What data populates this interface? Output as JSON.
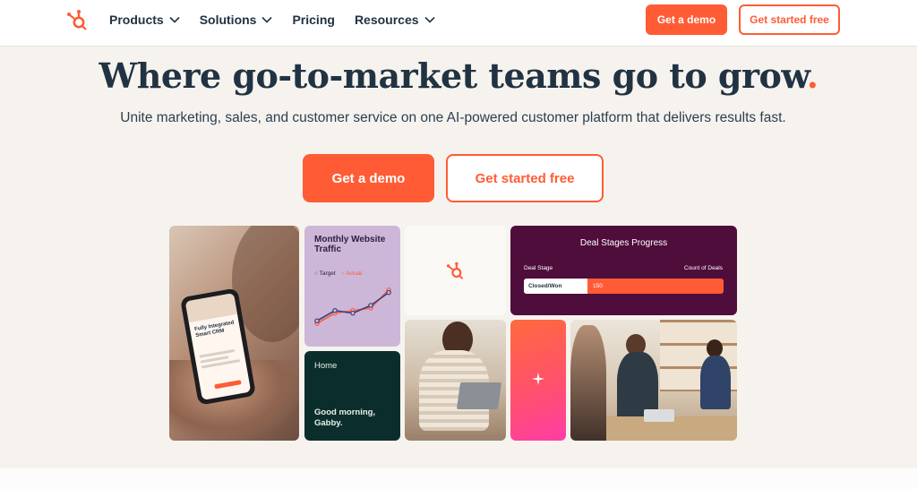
{
  "header": {
    "nav": [
      {
        "label": "Products",
        "has_chevron": true
      },
      {
        "label": "Solutions",
        "has_chevron": true
      },
      {
        "label": "Pricing",
        "has_chevron": false
      },
      {
        "label": "Resources",
        "has_chevron": true
      }
    ],
    "demo_label": "Get a demo",
    "free_label": "Get started free"
  },
  "hero": {
    "title": "Where go-to-market teams go to grow",
    "title_dot": ".",
    "subtitle": "Unite marketing, sales, and customer service on one AI-powered customer platform that delivers results fast.",
    "demo_label": "Get a demo",
    "free_label": "Get started free"
  },
  "tiles": {
    "phone_text": "Fully Integrated Smart CRM",
    "traffic": {
      "title": "Monthly Website Traffic",
      "legend_target": "Target",
      "legend_actual": "Actual",
      "target": [
        1,
        3,
        2.5,
        4,
        6.5
      ],
      "actual": [
        0.5,
        2.5,
        3,
        3.5,
        7
      ]
    },
    "deal": {
      "title": "Deal Stages Progress",
      "stage_header": "Deal Stage",
      "count_header": "Count of Deals",
      "stage": "Closed/Won",
      "count": "150"
    },
    "home": {
      "label": "Home",
      "greeting": "Good morning, Gabby."
    }
  },
  "colors": {
    "brand": "#ff5c35",
    "ink": "#213343",
    "deal_bg": "#4f0d3c",
    "home_bg": "#0b2e2c"
  }
}
